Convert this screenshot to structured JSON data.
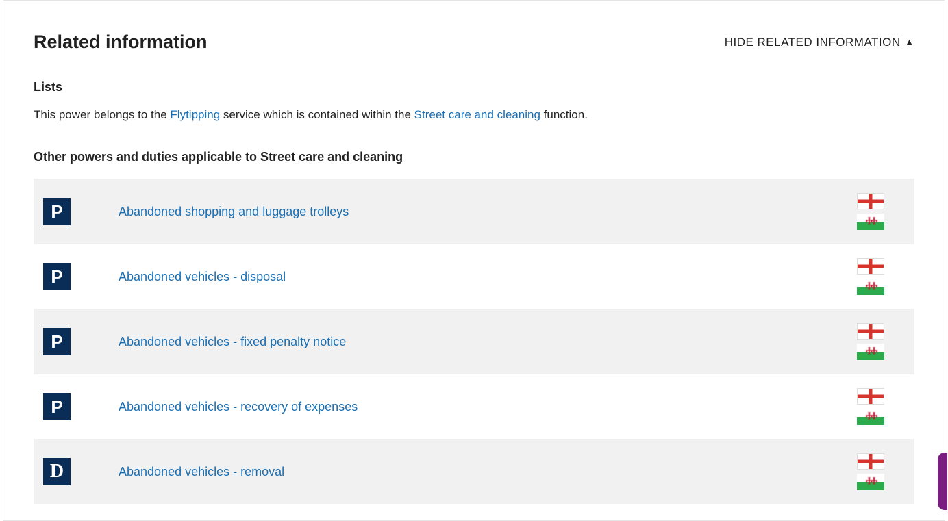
{
  "header": {
    "title": "Related information",
    "toggle_label": "HIDE RELATED INFORMATION"
  },
  "lists": {
    "heading": "Lists",
    "intro_prefix": "This power belongs to the ",
    "service_link": "Flytipping",
    "intro_mid": " service which is contained within the ",
    "function_link": "Street care and cleaning",
    "intro_suffix": " function."
  },
  "other_heading": "Other powers and duties applicable to Street care and cleaning",
  "rows": [
    {
      "badge": "P",
      "label": "Abandoned shopping and luggage trolleys",
      "flags": [
        "england",
        "wales"
      ]
    },
    {
      "badge": "P",
      "label": "Abandoned vehicles - disposal",
      "flags": [
        "england",
        "wales"
      ]
    },
    {
      "badge": "P",
      "label": "Abandoned vehicles - fixed penalty notice",
      "flags": [
        "england",
        "wales"
      ]
    },
    {
      "badge": "P",
      "label": "Abandoned vehicles - recovery of expenses",
      "flags": [
        "england",
        "wales"
      ]
    },
    {
      "badge": "D",
      "label": "Abandoned vehicles - removal",
      "flags": [
        "england",
        "wales"
      ]
    }
  ]
}
